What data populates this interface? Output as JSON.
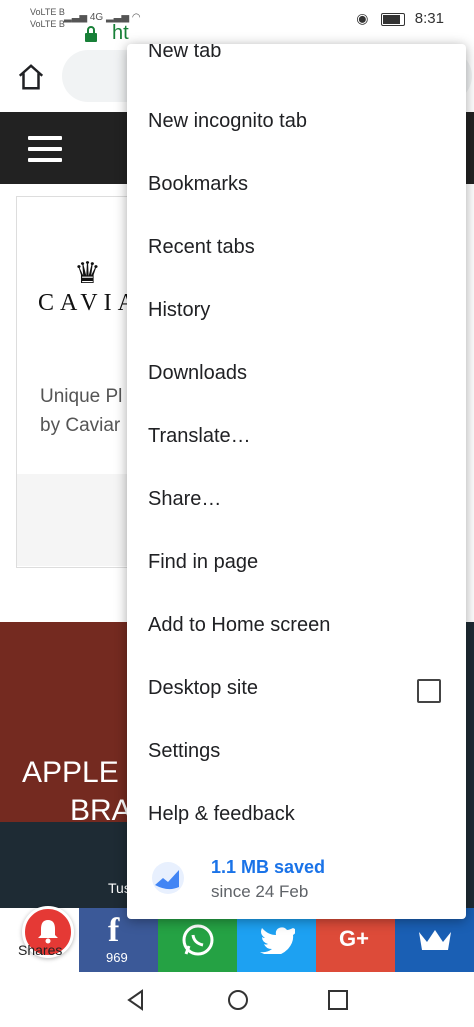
{
  "status_bar": {
    "left_line1": "VoLTE B",
    "left_line2": "VoLTE B",
    "network": "4G",
    "time": "8:31"
  },
  "browser": {
    "url_partial": "ht"
  },
  "page": {
    "logo_word": "CAVIA",
    "card_desc_line1": "Unique Pl",
    "card_desc_line2": "by Caviar",
    "hero_line1": "APPLE",
    "hero_line2": "BRA",
    "hero_line3": "Tus",
    "share_label": "Shares",
    "fb_count": "969"
  },
  "menu": {
    "items": [
      {
        "label": "New tab"
      },
      {
        "label": "New incognito tab"
      },
      {
        "label": "Bookmarks"
      },
      {
        "label": "Recent tabs"
      },
      {
        "label": "History"
      },
      {
        "label": "Downloads"
      },
      {
        "label": "Translate…"
      },
      {
        "label": "Share…"
      },
      {
        "label": "Find in page"
      },
      {
        "label": "Add to Home screen"
      },
      {
        "label": "Desktop site"
      },
      {
        "label": "Settings"
      },
      {
        "label": "Help & feedback"
      }
    ],
    "saver_main": "1.1 MB saved",
    "saver_sub": "since 24 Feb"
  },
  "colors": {
    "facebook": "#3b5998",
    "whatsapp": "#25a244",
    "twitter": "#1da1f2",
    "googleplus": "#dd4b39",
    "accent": "#1a73e8",
    "secure_green": "#188038"
  }
}
